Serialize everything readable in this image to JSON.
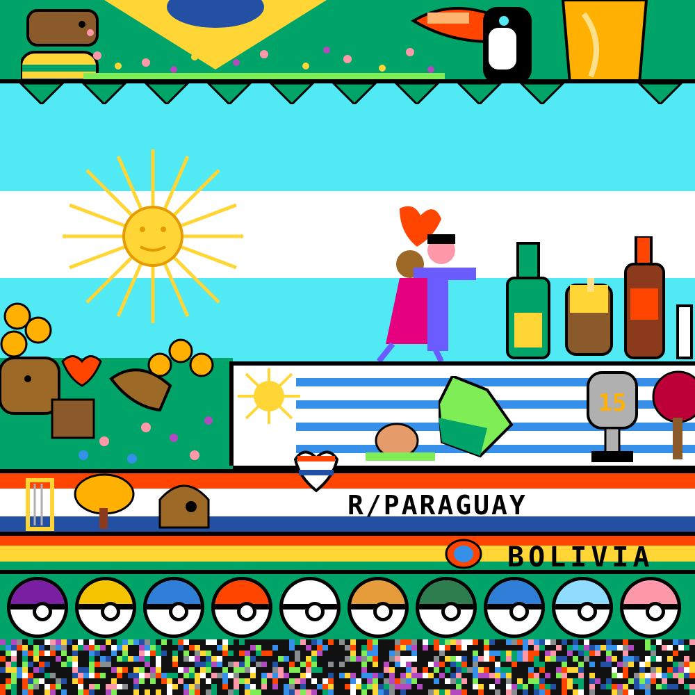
{
  "canvas": {
    "title": "",
    "palette": {
      "brazil_green": "#00a368",
      "sky_blue": "#51e9f4",
      "white": "#ffffff",
      "sun_yellow": "#ffd635",
      "paraguay_red": "#ff4500",
      "paraguay_blue": "#2450a4",
      "uruguay_blue": "#3690ea",
      "black": "#000000"
    }
  },
  "regions": {
    "brazil": {
      "icons": [
        "capybara-icon",
        "toucan-icon",
        "world-cup-trophy-icon",
        "flowers-icon"
      ]
    },
    "argentina": {
      "icons": [
        "sun-of-may-icon",
        "tango-dancers-icon",
        "heart-icon",
        "wine-bottle-icon",
        "mate-cup-icon",
        "fernet-bottle-icon"
      ]
    },
    "uruguay": {
      "icons": [
        "sun-of-may-icon",
        "snail-icon",
        "green-gem-icon",
        "trophy-15-icon",
        "tree-icon"
      ],
      "trophy_number": "15"
    },
    "paraguay": {
      "label": "R/PARAGUAY",
      "icons": [
        "harp-icon",
        "tree-icon",
        "hut-icon",
        "heart-flag-icon"
      ]
    },
    "bolivia": {
      "label": "BOLIVIA",
      "icons": [
        "bolivia-shield-icon"
      ]
    }
  },
  "pokeballs": [
    {
      "name": "master-ball",
      "top": "#7b1fa2"
    },
    {
      "name": "ultra-ball",
      "top": "#f5c400"
    },
    {
      "name": "great-ball",
      "top": "#2f7fd8"
    },
    {
      "name": "poke-ball",
      "top": "#ff4500"
    },
    {
      "name": "premier-ball",
      "top": "#ffffff"
    },
    {
      "name": "dusk-ball",
      "top": "#e59b3a"
    },
    {
      "name": "nest-ball",
      "top": "#2e7d4f"
    },
    {
      "name": "dive-ball",
      "top": "#2f7fd8"
    },
    {
      "name": "crystal-ball",
      "top": "#8fdcff"
    },
    {
      "name": "love-ball",
      "top": "#ff99aa"
    }
  ]
}
